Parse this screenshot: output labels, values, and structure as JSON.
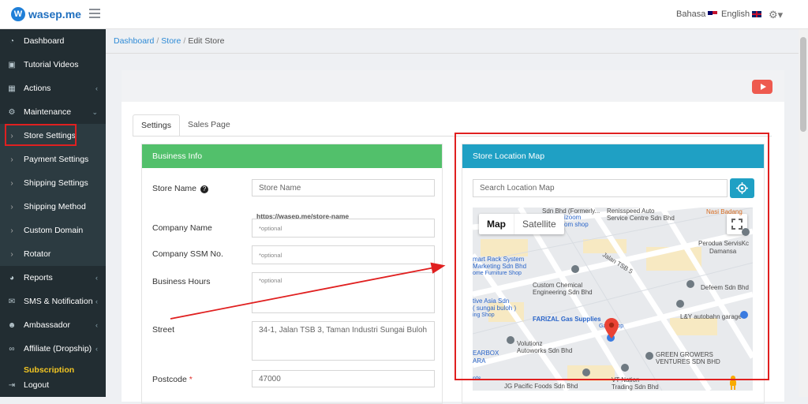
{
  "brand": {
    "name": "wasep.me",
    "mark": "W"
  },
  "header": {
    "lang_bahasa": "Bahasa",
    "lang_english": "English",
    "settings_icon": "gear-icon"
  },
  "sidebar": {
    "items": [
      {
        "label": "Dashboard",
        "icon": "dashboard-icon"
      },
      {
        "label": "Tutorial Videos",
        "icon": "video-icon"
      },
      {
        "label": "Actions",
        "icon": "grid-icon",
        "arrow": "‹"
      },
      {
        "label": "Maintenance",
        "icon": "gear-icon",
        "arrow": "⌄"
      },
      {
        "label": "Store Settings",
        "icon": "chevron-right-icon",
        "sub": true
      },
      {
        "label": "Payment Settings",
        "icon": "chevron-right-icon",
        "sub": true
      },
      {
        "label": "Shipping Settings",
        "icon": "chevron-right-icon",
        "sub": true
      },
      {
        "label": "Shipping Method",
        "icon": "chevron-right-icon",
        "sub": true
      },
      {
        "label": "Custom Domain",
        "icon": "chevron-right-icon",
        "sub": true
      },
      {
        "label": "Rotator",
        "icon": "chevron-right-icon",
        "sub": true
      },
      {
        "label": "Reports",
        "icon": "pie-chart-icon",
        "arrow": "‹"
      },
      {
        "label": "SMS & Notification",
        "icon": "mail-icon",
        "arrow": "‹"
      },
      {
        "label": "Ambassador",
        "icon": "users-icon",
        "arrow": "‹"
      },
      {
        "label": "Affiliate (Dropship)",
        "icon": "link-icon",
        "arrow": "‹"
      }
    ],
    "subscription": "Subscription",
    "logout": "Logout"
  },
  "breadcrumb": {
    "home": "Dashboard",
    "store": "Store",
    "current": "Edit Store"
  },
  "tabs": {
    "settings": "Settings",
    "sales_page": "Sales Page"
  },
  "business_info": {
    "title": "Business Info",
    "store_name_label": "Store Name",
    "store_name_placeholder": "Store Name",
    "store_url_hint": "https://wasep.me/store-name",
    "company_name_label": "Company Name",
    "company_name_placeholder": "*optional",
    "company_ssm_label": "Company SSM No.",
    "company_ssm_placeholder": "*optional",
    "business_hours_label": "Business Hours",
    "business_hours_placeholder": "*optional",
    "street_label": "Street",
    "street_value": "34-1, Jalan TSB 3, Taman Industri Sungai Buloh",
    "postcode_label": "Postcode",
    "postcode_required": "*",
    "postcode_value": "47000"
  },
  "store_map": {
    "title": "Store Location Map",
    "search_placeholder": "Search Location Map",
    "map_tab": "Map",
    "satellite_tab": "Satellite",
    "labels": {
      "l1": "Sdn Bhd (Formerly...",
      "l2": "Renisspeed Auto",
      "l3": "Service Centre Sdn Bhd",
      "l4": "Nasi Badang",
      "l5": "izoom",
      "l6": "om shop",
      "l7": "Perodua ServisKc",
      "l8": "Damansa",
      "l9": "mart Rack System",
      "l10": "Marketing Sdn Bhd",
      "l11": "ome Furniture Shop",
      "l12": "Jalan TSB 5",
      "l13": "Custom Chemical",
      "l14": "Engineering Sdn Bhd",
      "l15": "Defeem Sdn Bhd",
      "l16": "tive Asia Sdn",
      "l17": "( sungai buloh )",
      "l18": "ing Shop",
      "l19": "L&Y autobahn garage",
      "l20": "FARIZAL Gas Supplies",
      "l21": "Gas Shop",
      "l22": "Volutionz",
      "l23": "Autoworks Sdn Bhd",
      "l24": "EARBOX",
      "l25": "ARA",
      "l26": "GREEN GROWERS",
      "l27": "VENTURES SDN BHD",
      "l28": "VT Nation",
      "l29": "Trading Sdn Bhd",
      "l30": "JG Pacific Foods Sdn Bhd",
      "l31": "nts"
    }
  }
}
